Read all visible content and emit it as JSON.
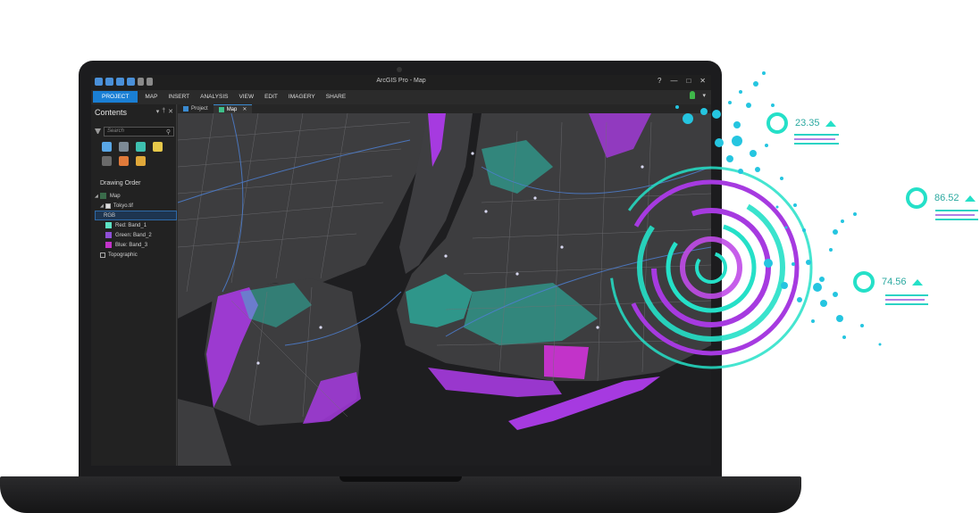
{
  "app": {
    "title": "ArcGIS Pro - Map"
  },
  "window_controls": [
    "?",
    "—",
    "□",
    "✕"
  ],
  "ribbon": {
    "tabs": [
      "PROJECT",
      "MAP",
      "INSERT",
      "ANALYSIS",
      "VIEW",
      "EDIT",
      "IMAGERY",
      "SHARE"
    ],
    "active": "PROJECT"
  },
  "contents": {
    "title": "Contents",
    "search_placeholder": "Search",
    "drawing_order_label": "Drawing Order",
    "layers": [
      {
        "label": "Map"
      },
      {
        "label": "Tokyo.tif"
      },
      {
        "label": "RGB"
      },
      {
        "label": "Red:  Band_1",
        "color": "#5de2c4"
      },
      {
        "label": "Green:  Band_2",
        "color": "#8e4fd6"
      },
      {
        "label": "Blue:  Band_3",
        "color": "#c233c9"
      },
      {
        "label": "Topographic"
      }
    ]
  },
  "view_tabs": [
    {
      "label": "Project"
    },
    {
      "label": "Map",
      "active": true
    }
  ],
  "stats": [
    {
      "value": "23.35"
    },
    {
      "value": "86.52"
    },
    {
      "value": "74.56"
    }
  ],
  "colors": {
    "teal": "#25e0c8",
    "purple": "#a63ae0",
    "magenta": "#c233c9",
    "accent_blue": "#1a7fd4",
    "water": "#1e1e20",
    "land": "#3d3d3f"
  }
}
